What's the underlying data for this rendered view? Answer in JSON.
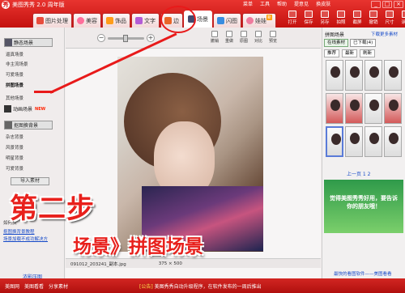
{
  "window": {
    "title": "美图秀秀 2.0 周年版",
    "logo": "秀",
    "menu": [
      "菜单",
      "工具",
      "帮助",
      "提意见",
      "换皮肤"
    ],
    "controls": [
      "_",
      "□",
      "×"
    ]
  },
  "tabs": [
    {
      "label": "图片处理",
      "icon": "image-icon",
      "color": "#e84c3d"
    },
    {
      "label": "美容",
      "icon": "beauty-icon",
      "color": "#ff6f9b"
    },
    {
      "label": "饰品",
      "icon": "ornament-icon",
      "color": "#ff9c1a"
    },
    {
      "label": "文字",
      "icon": "text-icon",
      "color": "#b35cd6"
    },
    {
      "label": "边",
      "icon": "border-icon",
      "color": "#e96528"
    },
    {
      "label": "场景",
      "icon": "scene-icon",
      "color": "#444a6e",
      "active": true
    },
    {
      "label": "闪图",
      "icon": "flash-icon",
      "color": "#3a8de0"
    },
    {
      "label": "娃娃",
      "icon": "doll-icon",
      "color": "#f07b9e",
      "badge": "新"
    }
  ],
  "right_tools": [
    "打开",
    "保存",
    "另存",
    "拍照",
    "截屏",
    "撤销",
    "尺寸",
    "涂鸦"
  ],
  "left_panel": {
    "group1": "静态场景",
    "group1_items": [
      "逼真场景",
      "非主流场景",
      "可爱场景",
      "拼图场景",
      "其他场景"
    ],
    "group2": "动画场景",
    "group2_badge": "NEW",
    "group3": "抠图换背景",
    "group3_items": [
      "杂志背景",
      "风景背景",
      "明星背景",
      "可爱背景"
    ],
    "import_button": "导入素材",
    "tips": [
      "抠图换背景教程",
      "场景加载不成功解决方"
    ],
    "tip_prefix": "如何换",
    "bottom_link": "浓影压图"
  },
  "center": {
    "zoom_minus": "−",
    "zoom_plus": "+",
    "toolbar_buttons": [
      "撤销",
      "重做",
      "原图",
      "对比",
      "预览"
    ],
    "filename": "091012_203241_副本.jpg",
    "dimensions": "375 × 500"
  },
  "right_panel": {
    "title": "拼图场景",
    "more_link": "下载更多素材",
    "tab_online": "在线素材",
    "tab_added": "已下载(4)",
    "sub_tabs": [
      "推荐",
      "最新",
      "刷新"
    ],
    "pager": "上一页 1 2",
    "promo": "觉得美图秀秀好用，要告诉你的朋友哦！",
    "footer": "最快的看图软件——美图看看"
  },
  "bottom_bar": {
    "items": [
      "美图网",
      "美图看看",
      "分享素材"
    ],
    "notice_label": "[公告]",
    "notice": "美图秀秀自动升级程序，在软件发布的一周后推出"
  },
  "annotation": {
    "step": "第二步",
    "path": "场景》拼图场景"
  }
}
